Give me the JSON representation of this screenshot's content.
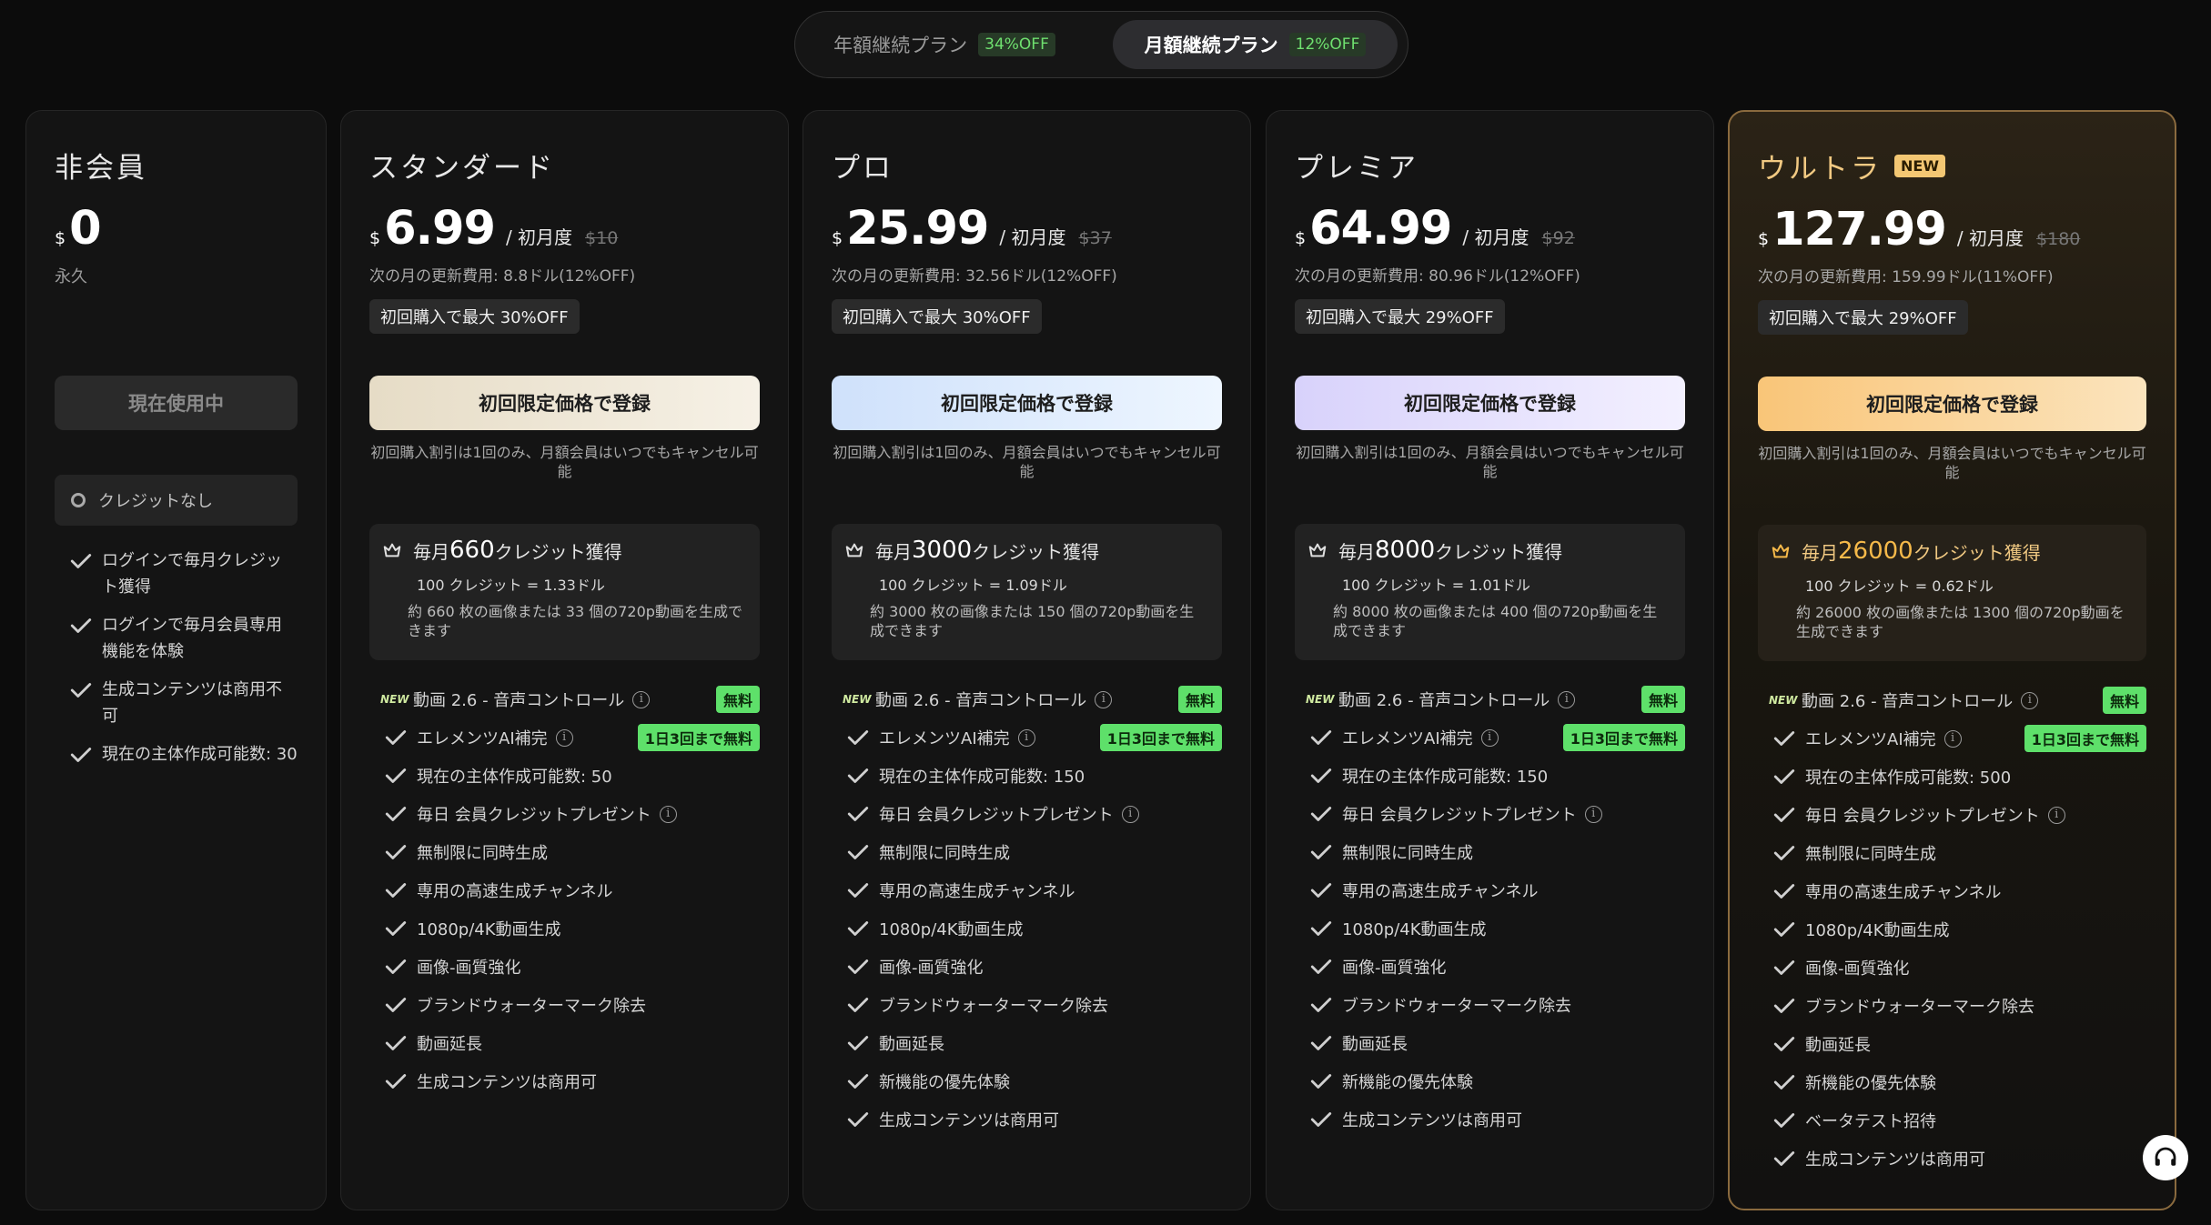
{
  "toggle": {
    "annual": {
      "label": "年額継続プラン",
      "badge": "34%OFF"
    },
    "monthly": {
      "label": "月額継続プラン",
      "badge": "12%OFF"
    }
  },
  "free_plan": {
    "name": "非会員",
    "currency": "$",
    "price": "0",
    "period": "永久",
    "button": "現在使用中",
    "credits": "クレジットなし",
    "features": [
      "ログインで毎月クレジット獲得",
      "ログインで毎月会員専用機能を体験",
      "生成コンテンツは商用不可",
      "現在の主体作成可能数: 30"
    ]
  },
  "common": {
    "per_label": "/ 初月度",
    "cta": "初回限定価格で登録",
    "note": "初回購入割引は1回のみ、月額会員はいつでもキャンセル可能",
    "badge_free": "無料",
    "badge_limit": "1日3回まで無料",
    "new_mini": "NEW"
  },
  "plans": [
    {
      "name": "スタンダード",
      "new_tag": "",
      "currency": "$",
      "price": "6.99",
      "orig": "$10",
      "renew": "次の月の更新費用: 8.8ドル(12%OFF)",
      "promo": "初回購入で最大 30%OFF",
      "credits_pre": "毎月",
      "credits_num": "660",
      "credits_post": "クレジット獲得",
      "rate": "100 クレジット = 1.33ドル",
      "desc": "約 660 枚の画像または 33 個の720p動画を生成できます",
      "features": [
        "動画 2.6 - 音声コントロール",
        "エレメンツAI補完",
        "現在の主体作成可能数: 50",
        "毎日 会員クレジットプレゼント",
        "無制限に同時生成",
        "専用の高速生成チャンネル",
        "1080p/4K動画生成",
        "画像-画質強化",
        "ブランドウォーターマーク除去",
        "動画延長",
        "生成コンテンツは商用可"
      ]
    },
    {
      "name": "プロ",
      "new_tag": "",
      "currency": "$",
      "price": "25.99",
      "orig": "$37",
      "renew": "次の月の更新費用: 32.56ドル(12%OFF)",
      "promo": "初回購入で最大 30%OFF",
      "credits_pre": "毎月",
      "credits_num": "3000",
      "credits_post": "クレジット獲得",
      "rate": "100 クレジット = 1.09ドル",
      "desc": "約 3000 枚の画像または 150 個の720p動画を生成できます",
      "features": [
        "動画 2.6 - 音声コントロール",
        "エレメンツAI補完",
        "現在の主体作成可能数: 150",
        "毎日 会員クレジットプレゼント",
        "無制限に同時生成",
        "専用の高速生成チャンネル",
        "1080p/4K動画生成",
        "画像-画質強化",
        "ブランドウォーターマーク除去",
        "動画延長",
        "新機能の優先体験",
        "生成コンテンツは商用可"
      ]
    },
    {
      "name": "プレミア",
      "new_tag": "",
      "currency": "$",
      "price": "64.99",
      "orig": "$92",
      "renew": "次の月の更新費用: 80.96ドル(12%OFF)",
      "promo": "初回購入で最大 29%OFF",
      "credits_pre": "毎月",
      "credits_num": "8000",
      "credits_post": "クレジット獲得",
      "rate": "100 クレジット = 1.01ドル",
      "desc": "約 8000 枚の画像または 400 個の720p動画を生成できます",
      "features": [
        "動画 2.6 - 音声コントロール",
        "エレメンツAI補完",
        "現在の主体作成可能数: 150",
        "毎日 会員クレジットプレゼント",
        "無制限に同時生成",
        "専用の高速生成チャンネル",
        "1080p/4K動画生成",
        "画像-画質強化",
        "ブランドウォーターマーク除去",
        "動画延長",
        "新機能の優先体験",
        "生成コンテンツは商用可"
      ]
    },
    {
      "name": "ウルトラ",
      "new_tag": "NEW",
      "currency": "$",
      "price": "127.99",
      "orig": "$180",
      "renew": "次の月の更新費用: 159.99ドル(11%OFF)",
      "promo": "初回購入で最大 29%OFF",
      "credits_pre": "毎月",
      "credits_num": "26000",
      "credits_post": "クレジット獲得",
      "rate": "100 クレジット = 0.62ドル",
      "desc": "約 26000 枚の画像または 1300 個の720p動画を生成できます",
      "features": [
        "動画 2.6 - 音声コントロール",
        "エレメンツAI補完",
        "現在の主体作成可能数: 500",
        "毎日 会員クレジットプレゼント",
        "無制限に同時生成",
        "専用の高速生成チャンネル",
        "1080p/4K動画生成",
        "画像-画質強化",
        "ブランドウォーターマーク除去",
        "動画延長",
        "新機能の優先体験",
        "ベータテスト招待",
        "生成コンテンツは商用可"
      ]
    }
  ],
  "colors": {
    "accent_green": "#5ee06a",
    "ultra_gold": "#f1c982"
  },
  "icons": {
    "check": "check-icon",
    "crown": "crown-icon",
    "info": "info-icon",
    "support": "headset-icon"
  }
}
